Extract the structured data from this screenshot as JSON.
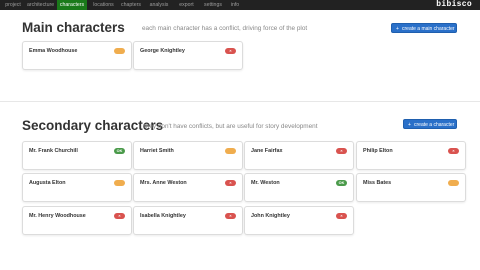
{
  "app": {
    "brand": "bibisco"
  },
  "nav": [
    "project",
    "architecture",
    "characters",
    "locations",
    "chapters",
    "analysis",
    "export",
    "settings",
    "info"
  ],
  "nav_active": "characters",
  "main_section": {
    "title": "Main characters",
    "subtitle": "each main character has a conflict, driving force of the plot",
    "create_label": "create a main character",
    "characters": [
      {
        "name": "Emma Woodhouse",
        "status": "warn",
        "status_text": ""
      },
      {
        "name": "George Knightley",
        "status": "danger",
        "status_text": "×"
      }
    ]
  },
  "secondary_section": {
    "title": "Secondary characters",
    "subtitle": "they don't have conflicts, but are useful for story development",
    "create_label": "create a character",
    "characters": [
      {
        "name": "Mr. Frank Churchill",
        "status": "ok",
        "status_text": "OK"
      },
      {
        "name": "Harriet Smith",
        "status": "warn",
        "status_text": ""
      },
      {
        "name": "Jane Fairfax",
        "status": "danger",
        "status_text": "×"
      },
      {
        "name": "Philip Elton",
        "status": "danger",
        "status_text": "×"
      },
      {
        "name": "Augusta Elton",
        "status": "warn",
        "status_text": ""
      },
      {
        "name": "Mrs. Anne Weston",
        "status": "danger",
        "status_text": "×"
      },
      {
        "name": "Mr. Weston",
        "status": "ok",
        "status_text": "OK"
      },
      {
        "name": "Miss Bates",
        "status": "warn",
        "status_text": ""
      },
      {
        "name": "Mr. Henry Woodhouse",
        "status": "danger",
        "status_text": "×"
      },
      {
        "name": "Isabella Knightley",
        "status": "danger",
        "status_text": "×"
      },
      {
        "name": "John Knightley",
        "status": "danger",
        "status_text": "×"
      }
    ]
  },
  "colors": {
    "navbar": "#222222",
    "nav_active": "#1a7a1a",
    "primary_button": "#2a70c9",
    "warn": "#f0ad4e",
    "danger": "#d9534f",
    "ok": "#4a9a4a"
  }
}
